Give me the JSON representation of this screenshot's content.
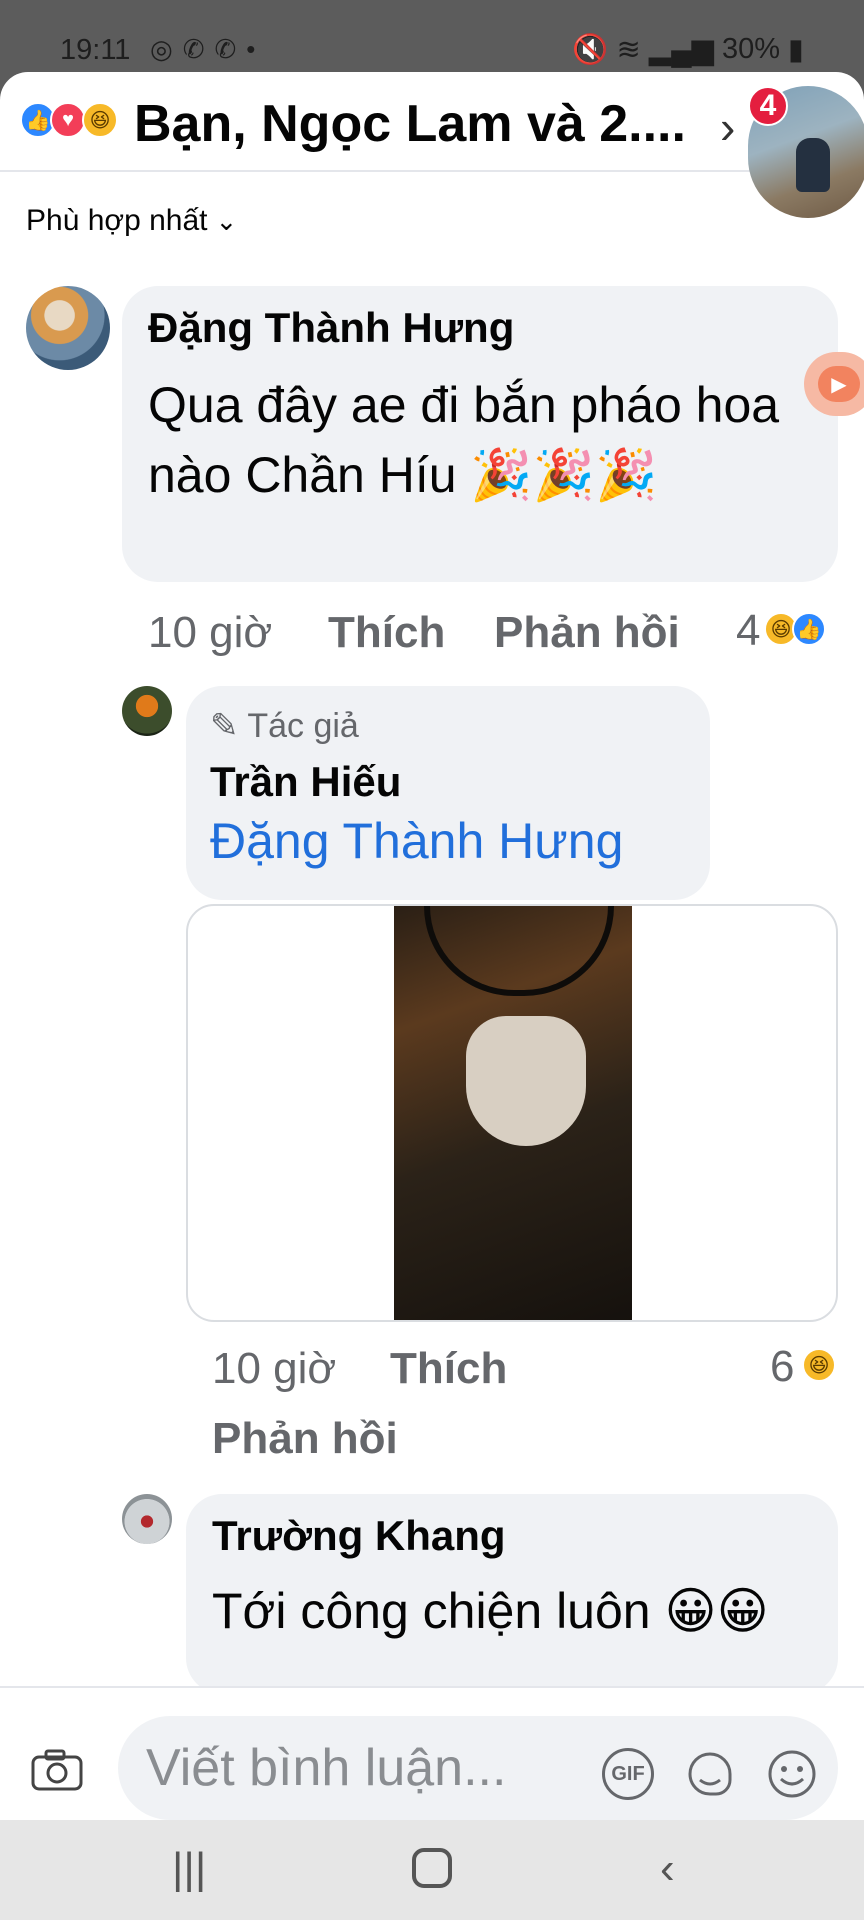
{
  "status_bar": {
    "time": "19:11",
    "battery": "30%"
  },
  "header": {
    "title": "Bạn, Ngọc Lam và 2....",
    "badge_count": "4",
    "reaction_icons": [
      "like-icon",
      "love-icon",
      "haha-icon"
    ]
  },
  "sort": {
    "label": "Phù hợp nhất"
  },
  "comments": [
    {
      "author": "Đặng Thành Hưng",
      "text": "Qua đây ae đi bắn pháo hoa nào Chần Híu 🎉🎉🎉",
      "time": "10 giờ",
      "like_label": "Thích",
      "reply_label": "Phản hồi",
      "reaction_count": "4"
    },
    {
      "author_badge": "Tác giả",
      "author": "Trần Hiếu",
      "mention": "Đặng Thành Hưng",
      "time": "10 giờ",
      "like_label": "Thích",
      "reply_label": "Phản hồi",
      "reaction_count": "6"
    },
    {
      "author": "Trường Khang",
      "text": "Tới công chiện luôn 😀😀"
    }
  ],
  "composer": {
    "placeholder": "Viết bình luận...",
    "gif_label": "GIF"
  }
}
